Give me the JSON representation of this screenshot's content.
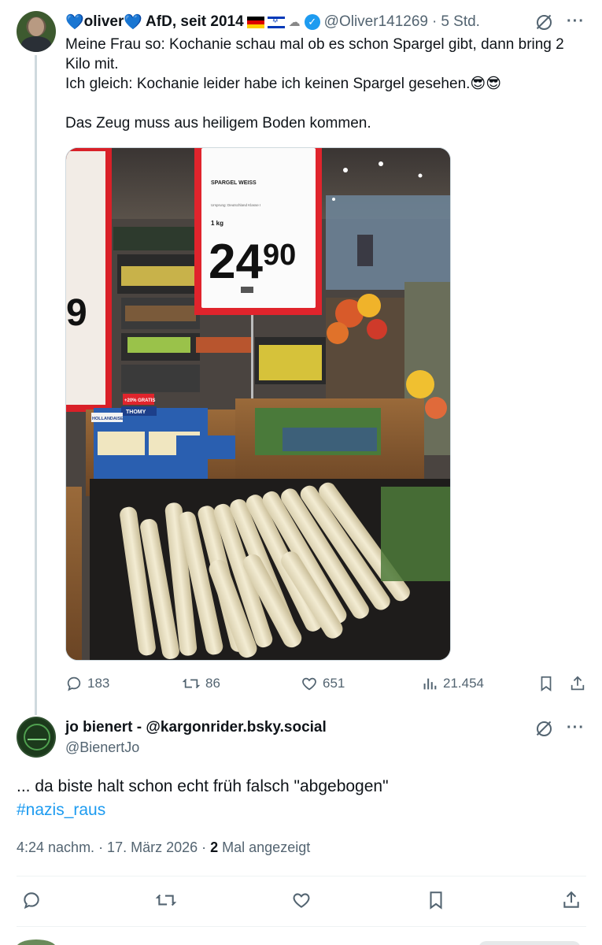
{
  "tweet1": {
    "display_name_a": "oliver",
    "display_name_b": "AfD, seit 2014",
    "handle": "@Oliver141269",
    "time": "5 Std.",
    "text_lines": [
      "Meine Frau so: Kochanie schau mal ob es schon Spargel gibt, dann bring 2 Kilo mit.",
      "Ich gleich: Kochanie leider habe ich keinen Spargel gesehen.😎😎",
      "Das Zeug muss aus heiligem Boden kommen."
    ],
    "photo": {
      "sign_product": "SPARGEL WEISS",
      "sign_origin": "Ursprung: Deutschland Klasse I",
      "sign_unit": "1 kg",
      "sign_price_main": "24",
      "sign_price_cents": "90",
      "left_sign_digit": "9",
      "tray_label": "+20% GRATIS",
      "tray_brand": "THOMY",
      "tray_product": "HOLLANDAISE"
    },
    "stats": {
      "replies": "183",
      "reposts": "86",
      "likes": "651",
      "views": "21.454"
    }
  },
  "tweet2": {
    "display_name": "jo bienert - @kargonrider.bsky.social",
    "handle": "@BienertJo",
    "text": "... da biste halt schon echt früh falsch \"abgebogen\"",
    "hashtag": "#nazis_raus",
    "timestamp": "4:24 nachm. · 17. März 2026 · ",
    "views_count": "2",
    "views_label": " Mal angezeigt"
  },
  "icons": {
    "reply": "reply-icon",
    "repost": "repost-icon",
    "like": "heart-icon",
    "views": "views-icon",
    "bookmark": "bookmark-icon",
    "share": "share-icon",
    "grok": "grok-icon",
    "more": "more-icon"
  },
  "colors": {
    "text": "#0f1419",
    "muted": "#536471",
    "accent": "#1d9bf0",
    "border": "#cfd9de",
    "price_red": "#e0242c"
  }
}
